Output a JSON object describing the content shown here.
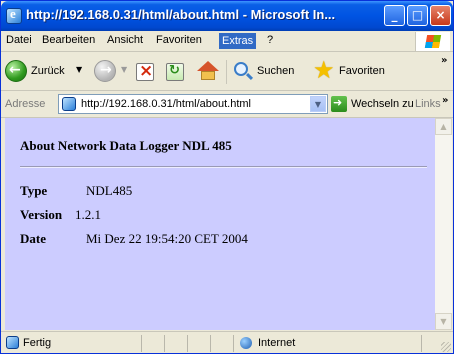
{
  "window": {
    "title": "http://192.168.0.31/html/about.html - Microsoft In...",
    "buttons": {
      "minimize": "_",
      "maximize": "□",
      "close": "×"
    }
  },
  "menu": [
    "Datei",
    "Bearbeiten",
    "Ansicht",
    "Favoriten",
    "Extras",
    "?"
  ],
  "menu_active": "Extras",
  "toolbar": {
    "back_label": "Zurück",
    "search_label": "Suchen",
    "favorites_label": "Favoriten",
    "more": "»"
  },
  "address": {
    "label": "Adresse",
    "url": "http://192.168.0.31/html/about.html",
    "go_label": "Wechseln zu",
    "links_label": "Links",
    "more": "»"
  },
  "content": {
    "heading": "About Network Data Logger NDL 485",
    "rows": [
      {
        "key": "Type",
        "value": "NDL485"
      },
      {
        "key": "Version",
        "value": "1.2.1"
      },
      {
        "key": "Date",
        "value": "Mi Dez 22 19:54:20 CET 2004"
      }
    ],
    "background": "#ccccff"
  },
  "status": {
    "text": "Fertig",
    "zone": "Internet"
  },
  "colors": {
    "titlebar": "#0054e3",
    "chrome": "#ece9d8",
    "menu_highlight": "#316ac5"
  }
}
